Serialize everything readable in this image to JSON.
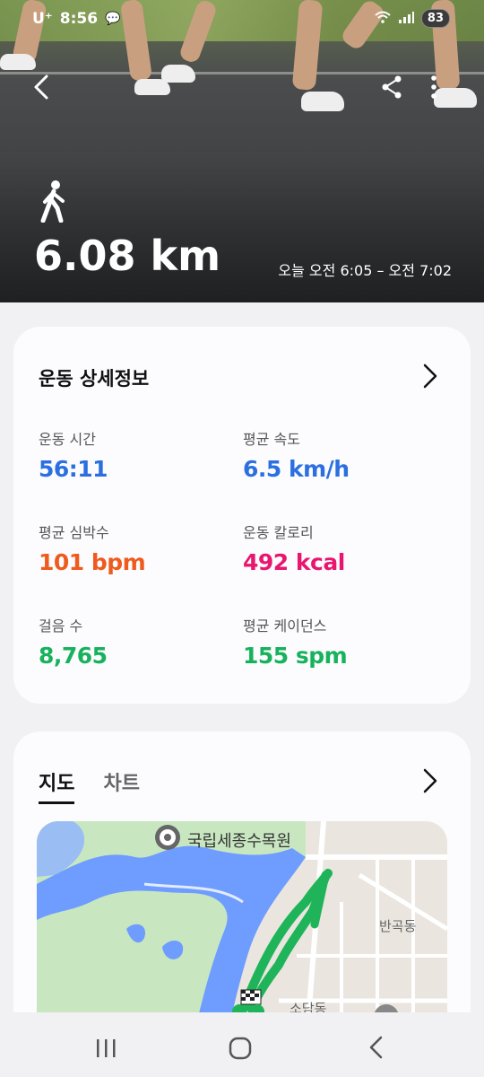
{
  "status_bar": {
    "carrier": "U⁺",
    "time": "8:56",
    "battery": "83"
  },
  "hero": {
    "distance": "6.08 km",
    "time_range": "오늘 오전 6:05 – 오전 7:02",
    "icons": {
      "back": "back-arrow-icon",
      "share": "share-icon",
      "more": "more-vertical-icon",
      "activity": "walking-icon"
    }
  },
  "details": {
    "title": "운동 상세정보",
    "stats": [
      {
        "label": "운동 시간",
        "value": "56:11",
        "color": "#2b6fe0"
      },
      {
        "label": "평균 속도",
        "value": "6.5 km/h",
        "color": "#2b6fe0"
      },
      {
        "label": "평균 심박수",
        "value": "101 bpm",
        "color": "#ee5b1e"
      },
      {
        "label": "운동 칼로리",
        "value": "492 kcal",
        "color": "#e8166f"
      },
      {
        "label": "걸음 수",
        "value": "8,765",
        "color": "#18b25c"
      },
      {
        "label": "평균 케이던스",
        "value": "155 spm",
        "color": "#18b25c"
      }
    ]
  },
  "map_section": {
    "tabs": [
      {
        "label": "지도",
        "active": true
      },
      {
        "label": "차트",
        "active": false
      }
    ],
    "map_labels": {
      "poi": "국립세종수목원",
      "district1": "반곡동",
      "district2": "소담동"
    }
  },
  "colors": {
    "route": "#1fb45a",
    "river": "#6e9cff",
    "park": "#c8e7c0"
  }
}
